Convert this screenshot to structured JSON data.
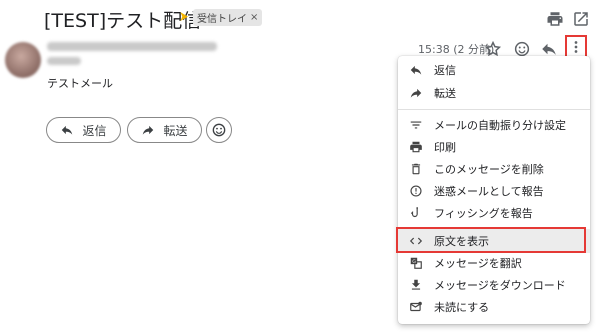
{
  "subject": "[TEST]テスト配信",
  "label_chip": {
    "text": "受信トレイ",
    "close": "×"
  },
  "timestamp": "15:38 (2 分前)",
  "body_text": "テストメール",
  "buttons": {
    "reply": "返信",
    "forward": "転送"
  },
  "menu": {
    "items": [
      {
        "label": "返信",
        "icon": "reply-icon"
      },
      {
        "label": "転送",
        "icon": "forward-icon"
      },
      {
        "label": "メールの自動振り分け設定",
        "icon": "filter-icon"
      },
      {
        "label": "印刷",
        "icon": "print-icon"
      },
      {
        "label": "このメッセージを削除",
        "icon": "trash-icon"
      },
      {
        "label": "迷惑メールとして報告",
        "icon": "spam-icon"
      },
      {
        "label": "フィッシングを報告",
        "icon": "phishing-hook-icon"
      },
      {
        "label": "原文を表示",
        "icon": "code-icon"
      },
      {
        "label": "メッセージを翻訳",
        "icon": "translate-icon"
      },
      {
        "label": "メッセージをダウンロード",
        "icon": "download-icon"
      },
      {
        "label": "未読にする",
        "icon": "mark-unread-icon"
      }
    ]
  },
  "colors": {
    "highlight_border": "#e53935",
    "important_marker": "#f4b400"
  }
}
